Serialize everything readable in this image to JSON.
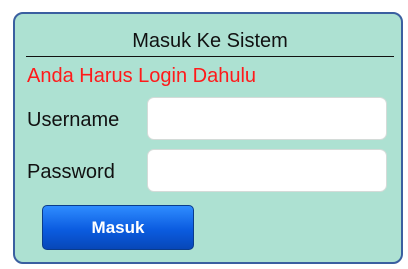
{
  "login_box": {
    "title": "Masuk Ke Sistem",
    "warning": "Anda Harus Login Dahulu",
    "username": {
      "label": "Username",
      "value": "",
      "placeholder": ""
    },
    "password": {
      "label": "Password",
      "value": "",
      "placeholder": ""
    },
    "submit_label": "Masuk"
  },
  "colors": {
    "panel_background": "#ade1d2",
    "panel_border": "#3a5fa0",
    "warning_text": "#ff1a1a",
    "button_blue": "#0b5ce0"
  }
}
